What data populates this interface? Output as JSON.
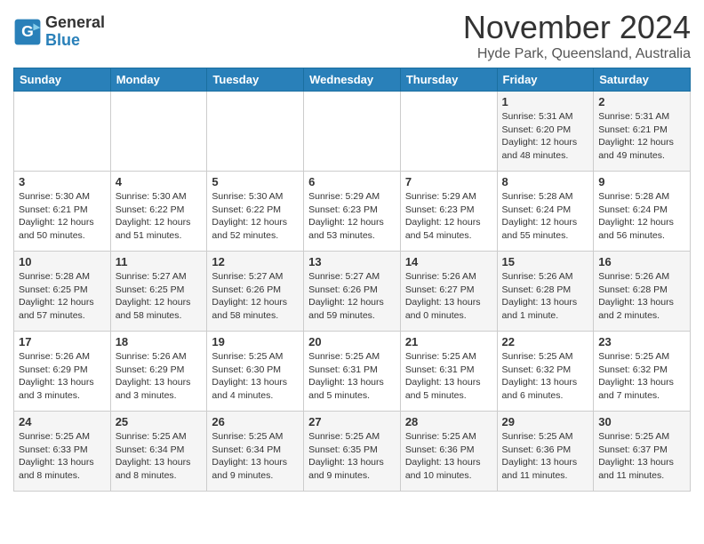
{
  "header": {
    "logo_line1": "General",
    "logo_line2": "Blue",
    "month": "November 2024",
    "location": "Hyde Park, Queensland, Australia"
  },
  "weekdays": [
    "Sunday",
    "Monday",
    "Tuesday",
    "Wednesday",
    "Thursday",
    "Friday",
    "Saturday"
  ],
  "weeks": [
    [
      {
        "day": "",
        "info": ""
      },
      {
        "day": "",
        "info": ""
      },
      {
        "day": "",
        "info": ""
      },
      {
        "day": "",
        "info": ""
      },
      {
        "day": "",
        "info": ""
      },
      {
        "day": "1",
        "info": "Sunrise: 5:31 AM\nSunset: 6:20 PM\nDaylight: 12 hours\nand 48 minutes."
      },
      {
        "day": "2",
        "info": "Sunrise: 5:31 AM\nSunset: 6:21 PM\nDaylight: 12 hours\nand 49 minutes."
      }
    ],
    [
      {
        "day": "3",
        "info": "Sunrise: 5:30 AM\nSunset: 6:21 PM\nDaylight: 12 hours\nand 50 minutes."
      },
      {
        "day": "4",
        "info": "Sunrise: 5:30 AM\nSunset: 6:22 PM\nDaylight: 12 hours\nand 51 minutes."
      },
      {
        "day": "5",
        "info": "Sunrise: 5:30 AM\nSunset: 6:22 PM\nDaylight: 12 hours\nand 52 minutes."
      },
      {
        "day": "6",
        "info": "Sunrise: 5:29 AM\nSunset: 6:23 PM\nDaylight: 12 hours\nand 53 minutes."
      },
      {
        "day": "7",
        "info": "Sunrise: 5:29 AM\nSunset: 6:23 PM\nDaylight: 12 hours\nand 54 minutes."
      },
      {
        "day": "8",
        "info": "Sunrise: 5:28 AM\nSunset: 6:24 PM\nDaylight: 12 hours\nand 55 minutes."
      },
      {
        "day": "9",
        "info": "Sunrise: 5:28 AM\nSunset: 6:24 PM\nDaylight: 12 hours\nand 56 minutes."
      }
    ],
    [
      {
        "day": "10",
        "info": "Sunrise: 5:28 AM\nSunset: 6:25 PM\nDaylight: 12 hours\nand 57 minutes."
      },
      {
        "day": "11",
        "info": "Sunrise: 5:27 AM\nSunset: 6:25 PM\nDaylight: 12 hours\nand 58 minutes."
      },
      {
        "day": "12",
        "info": "Sunrise: 5:27 AM\nSunset: 6:26 PM\nDaylight: 12 hours\nand 58 minutes."
      },
      {
        "day": "13",
        "info": "Sunrise: 5:27 AM\nSunset: 6:26 PM\nDaylight: 12 hours\nand 59 minutes."
      },
      {
        "day": "14",
        "info": "Sunrise: 5:26 AM\nSunset: 6:27 PM\nDaylight: 13 hours\nand 0 minutes."
      },
      {
        "day": "15",
        "info": "Sunrise: 5:26 AM\nSunset: 6:28 PM\nDaylight: 13 hours\nand 1 minute."
      },
      {
        "day": "16",
        "info": "Sunrise: 5:26 AM\nSunset: 6:28 PM\nDaylight: 13 hours\nand 2 minutes."
      }
    ],
    [
      {
        "day": "17",
        "info": "Sunrise: 5:26 AM\nSunset: 6:29 PM\nDaylight: 13 hours\nand 3 minutes."
      },
      {
        "day": "18",
        "info": "Sunrise: 5:26 AM\nSunset: 6:29 PM\nDaylight: 13 hours\nand 3 minutes."
      },
      {
        "day": "19",
        "info": "Sunrise: 5:25 AM\nSunset: 6:30 PM\nDaylight: 13 hours\nand 4 minutes."
      },
      {
        "day": "20",
        "info": "Sunrise: 5:25 AM\nSunset: 6:31 PM\nDaylight: 13 hours\nand 5 minutes."
      },
      {
        "day": "21",
        "info": "Sunrise: 5:25 AM\nSunset: 6:31 PM\nDaylight: 13 hours\nand 5 minutes."
      },
      {
        "day": "22",
        "info": "Sunrise: 5:25 AM\nSunset: 6:32 PM\nDaylight: 13 hours\nand 6 minutes."
      },
      {
        "day": "23",
        "info": "Sunrise: 5:25 AM\nSunset: 6:32 PM\nDaylight: 13 hours\nand 7 minutes."
      }
    ],
    [
      {
        "day": "24",
        "info": "Sunrise: 5:25 AM\nSunset: 6:33 PM\nDaylight: 13 hours\nand 8 minutes."
      },
      {
        "day": "25",
        "info": "Sunrise: 5:25 AM\nSunset: 6:34 PM\nDaylight: 13 hours\nand 8 minutes."
      },
      {
        "day": "26",
        "info": "Sunrise: 5:25 AM\nSunset: 6:34 PM\nDaylight: 13 hours\nand 9 minutes."
      },
      {
        "day": "27",
        "info": "Sunrise: 5:25 AM\nSunset: 6:35 PM\nDaylight: 13 hours\nand 9 minutes."
      },
      {
        "day": "28",
        "info": "Sunrise: 5:25 AM\nSunset: 6:36 PM\nDaylight: 13 hours\nand 10 minutes."
      },
      {
        "day": "29",
        "info": "Sunrise: 5:25 AM\nSunset: 6:36 PM\nDaylight: 13 hours\nand 11 minutes."
      },
      {
        "day": "30",
        "info": "Sunrise: 5:25 AM\nSunset: 6:37 PM\nDaylight: 13 hours\nand 11 minutes."
      }
    ]
  ]
}
